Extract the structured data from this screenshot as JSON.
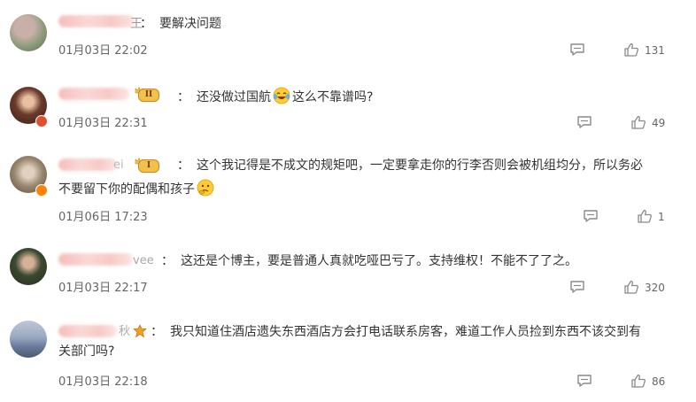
{
  "comments": [
    {
      "text": "要解决问题",
      "name_tail": "王",
      "time": "01月03日 22:02",
      "likes": "131",
      "level": "",
      "avatar_colors": [
        "#8a9a7a",
        "#c8b0a8"
      ]
    },
    {
      "text_part1": "还没做过国航",
      "text_part2": "这么不靠谱吗?",
      "emoji": "laughing-tears-emoji",
      "time": "01月03日 22:31",
      "likes": "49",
      "level": "II",
      "avatar_colors": [
        "#6b3a2a",
        "#d06040"
      ]
    },
    {
      "name_tail": "ei",
      "text_line1": "这个我记得是不成文的规矩吧，一定要拿走你的行李否则会被机组均分，所以务必",
      "text_line2": "不要留下你的配偶和孩子",
      "emoji": "thinking-emoji",
      "time": "01月06日 17:23",
      "likes": "1",
      "level": "I",
      "avatar_colors": [
        "#9a8870",
        "#d8c8b0"
      ]
    },
    {
      "name_tail": "vee",
      "text": "这还是个博主，要是普通人真就吃哑巴亏了。支持维权！不能不了了之。",
      "time": "01月03日 22:17",
      "likes": "320",
      "level": "",
      "avatar_colors": [
        "#3a4a30",
        "#c8a080"
      ]
    },
    {
      "name_tail": "秋",
      "text_line1": "我只知道住酒店遗失东西酒店方会打电话联系房客，难道工作人员捡到东西不该交到有",
      "text_line2": "关部门吗?",
      "time": "01月03日 22:18",
      "likes": "86",
      "level": "",
      "avatar_colors": [
        "#6a7a9a",
        "#c0c8d8"
      ]
    }
  ],
  "separator": "：",
  "icons": {
    "reply": "comment-icon",
    "like": "thumbs-up-icon",
    "verified": "verified-badge-icon",
    "crown": "crown-icon"
  },
  "colors": {
    "name_blur": "#f4b3b0",
    "time": "#666666",
    "icon": "#8a8a8a",
    "level_gold": "#f3c14b"
  }
}
